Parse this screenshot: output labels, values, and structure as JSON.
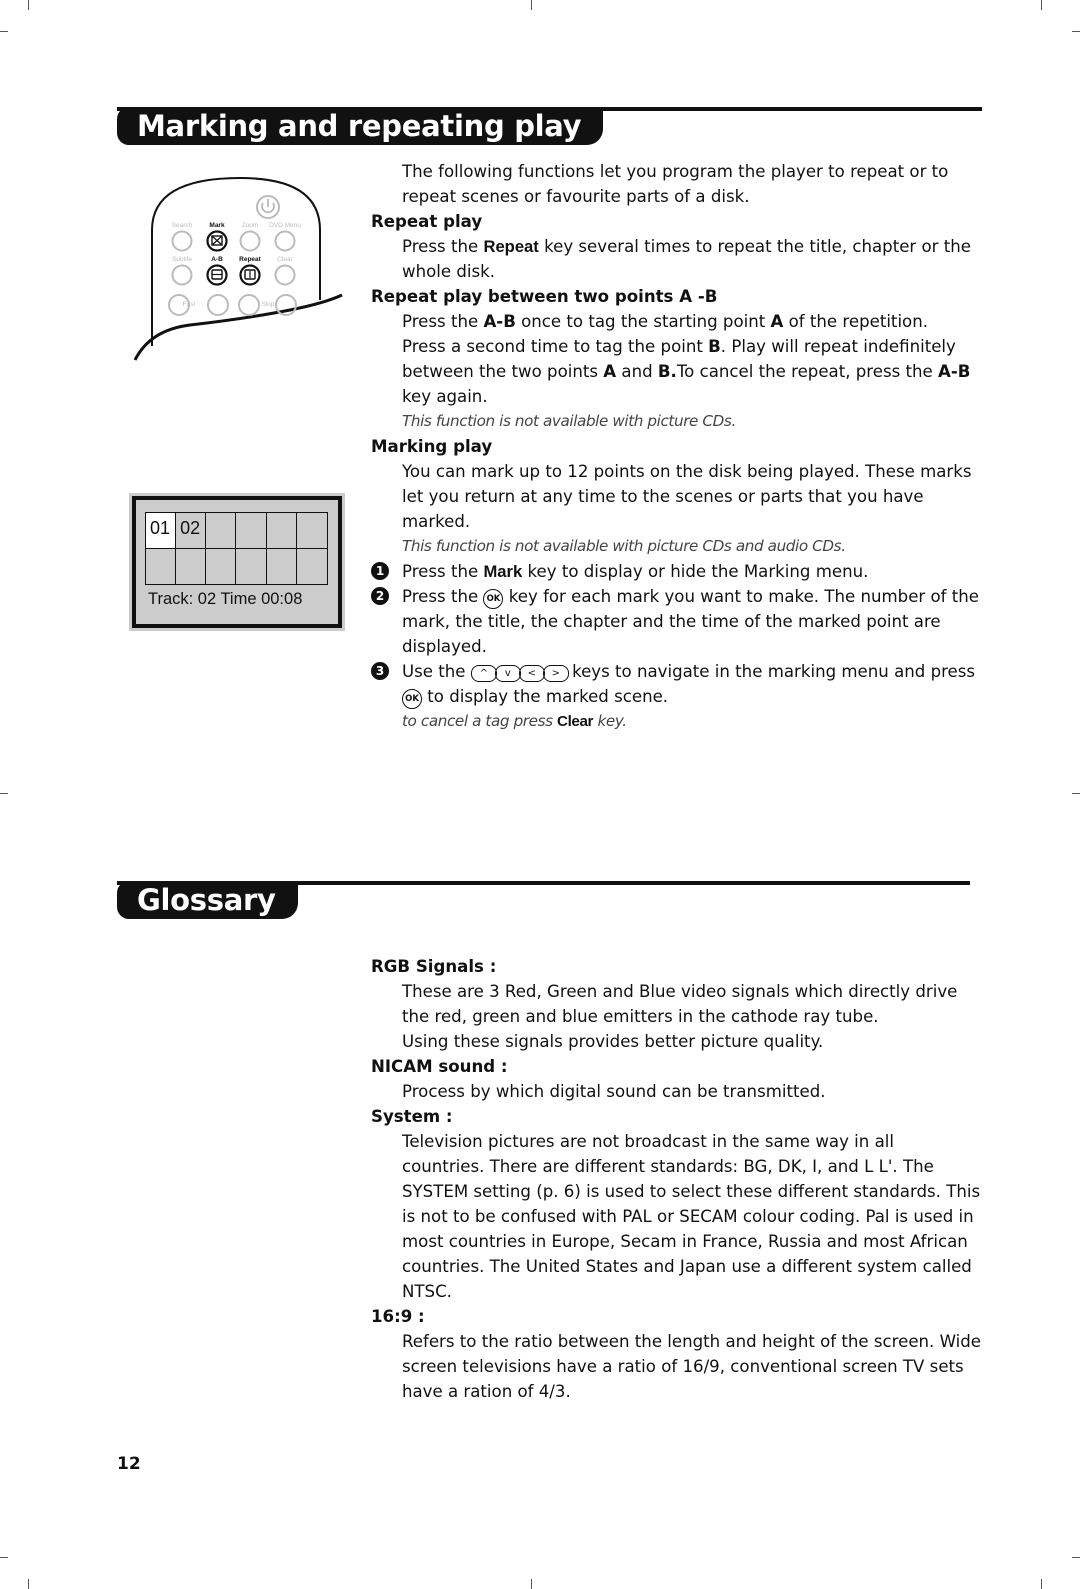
{
  "section1": {
    "title": "Marking and repeating play",
    "intro": "The following functions let you program the player to repeat or to repeat scenes or favourite parts of a disk.",
    "repeat_play": {
      "heading": "Repeat play",
      "text_before": "Press the ",
      "key": "Repeat",
      "text_after": " key several times to repeat the title, chapter or the whole disk."
    },
    "ab_play": {
      "heading": "Repeat play between two points A -B",
      "line1_a": "Press the ",
      "line1_key": "A-B",
      "line1_b": " once to tag the starting point ",
      "line1_pt": "A",
      "line1_c": " of the repetition.",
      "line2_a": "Press a second time to tag the point ",
      "line2_pt": "B",
      "line2_b": ". Play will repeat indefinitely between the two points ",
      "line2_ptA": "A",
      "line2_c": " and ",
      "line2_ptB": "B.",
      "line2_d": "To cancel the repeat, press the ",
      "line2_key": "A-B",
      "line2_e": " key again.",
      "note": "This function is not available with picture CDs."
    },
    "marking_play": {
      "heading": "Marking play",
      "text": "You can mark up to 12 points on the disk being played. These marks let you return at any time to the scenes or parts that you have marked.",
      "note": "This function is not available with picture CDs and audio CDs.",
      "steps": [
        {
          "num": "1",
          "a": "Press the ",
          "key": "Mark",
          "b": " key to display or hide the Marking menu."
        },
        {
          "num": "2",
          "a": "Press the ",
          "okkey": "OK",
          "b": " key for each mark you want to make. The number of the mark, the title, the chapter and the time of the marked point are displayed."
        },
        {
          "num": "3",
          "a": "Use the ",
          "navkeys": [
            "^",
            "v",
            "<",
            ">"
          ],
          "b": " keys to navigate in the marking menu and press ",
          "okkey": "OK",
          "c": " to display the marked scene."
        }
      ],
      "cancel_note_a": "to cancel a tag press ",
      "cancel_note_key": "Clear",
      "cancel_note_b": " key."
    }
  },
  "remote": {
    "row1_labels": [
      "Search",
      "Mark",
      "Zoom",
      "DVD Menu"
    ],
    "row2_labels": [
      "Subtile",
      "A-B",
      "Repeat",
      "Clear"
    ],
    "row3_labels": [
      "Fast",
      "Skip"
    ],
    "highlighted_keys": [
      "Mark",
      "A-B",
      "Repeat"
    ],
    "icons": [
      "power-icon"
    ]
  },
  "osd": {
    "cells": [
      "01",
      "02",
      "",
      "",
      "",
      "",
      "",
      "",
      "",
      "",
      "",
      ""
    ],
    "active_index": 0,
    "status": "Track: 02 Time 00:08"
  },
  "section2": {
    "title": "Glossary",
    "entries": [
      {
        "term": "RGB Signals :",
        "lines": [
          "These are 3 Red, Green and Blue video signals which directly drive the red, green and blue emitters in the cathode ray tube.",
          "Using these signals provides better picture quality."
        ]
      },
      {
        "term": "NICAM sound :",
        "lines": [
          "Process by which digital sound can be transmitted."
        ]
      },
      {
        "term": "System :",
        "lines": [
          "Television pictures are not broadcast in the same way in all countries. There are different standards: BG, DK, I, and L L'. The SYSTEM setting (p. 6) is used to select these different standards. This is not to be confused with PAL or SECAM colour coding. Pal is used in most countries in Europe, Secam in France, Russia and most African countries. The United States and Japan use a different system called NTSC."
        ]
      },
      {
        "term": "16:9 :",
        "lines": [
          "Refers to the ratio between the length and height of the screen. Wide screen televisions have a ratio of 16/9, conventional screen TV sets have a ration of 4/3."
        ]
      }
    ]
  },
  "page_number": "12"
}
